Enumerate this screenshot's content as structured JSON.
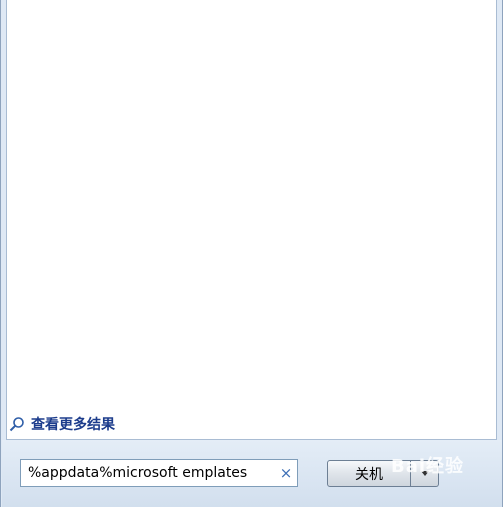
{
  "results": {
    "more_results_label": "查看更多结果"
  },
  "search": {
    "value": "%appdata%microsoft emplates",
    "clear_glyph": "×"
  },
  "shutdown": {
    "label": "关机"
  },
  "watermark": {
    "text": "Bai经验"
  }
}
